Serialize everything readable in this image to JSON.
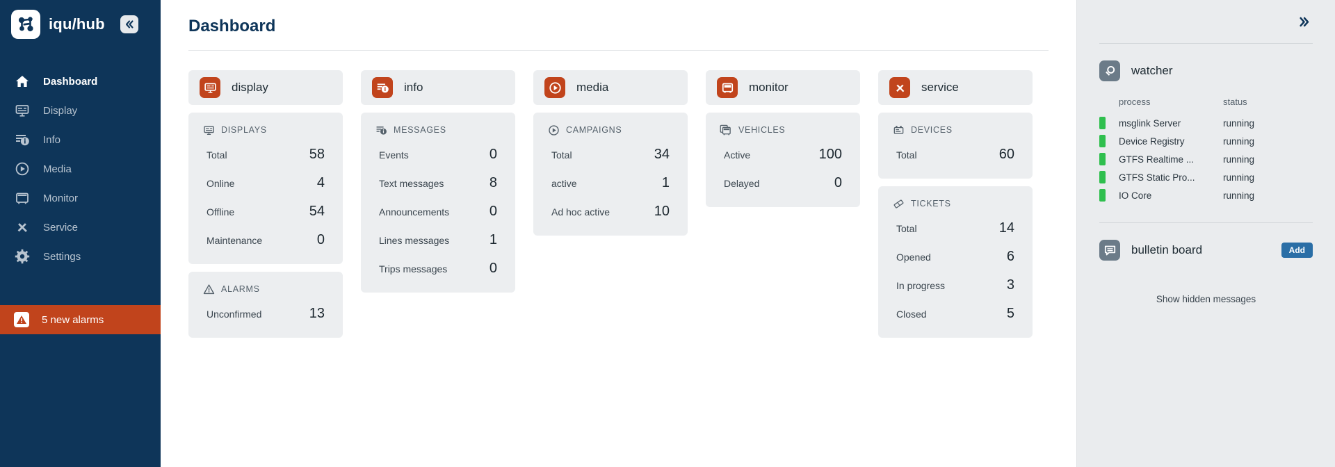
{
  "sidebar": {
    "brand": {
      "name": "iqu/hub",
      "logo_icon": "molecule-logo-icon"
    },
    "collapse_label": "«",
    "items": [
      {
        "label": "Dashboard",
        "icon": "home-icon",
        "active": true
      },
      {
        "label": "Display",
        "icon": "display-board-icon",
        "active": false
      },
      {
        "label": "Info",
        "icon": "info-list-icon",
        "active": false
      },
      {
        "label": "Media",
        "icon": "play-circle-icon",
        "active": false
      },
      {
        "label": "Monitor",
        "icon": "bus-front-icon",
        "active": false
      },
      {
        "label": "Service",
        "icon": "tools-icon",
        "active": false
      },
      {
        "label": "Settings",
        "icon": "gear-icon",
        "active": false
      }
    ],
    "alarm": {
      "label": "5 new alarms",
      "icon": "alarm-warning-icon",
      "color": "#c1441c"
    }
  },
  "header": {
    "title": "Dashboard"
  },
  "colors": {
    "sidebar_bg": "#0e3559",
    "accent_red": "#c1441c",
    "card_bg": "#eceef0",
    "right_panel_bg": "#eaecee",
    "status_green": "#2fbf4e",
    "add_blue": "#2a6ea6"
  },
  "columns": [
    {
      "app": {
        "name": "display",
        "icon": "display-board-icon"
      },
      "panels": [
        {
          "title": "DISPLAYS",
          "icon": "display-board-icon",
          "rows": [
            {
              "label": "Total",
              "value": "58"
            },
            {
              "label": "Online",
              "value": "4"
            },
            {
              "label": "Offline",
              "value": "54"
            },
            {
              "label": "Maintenance",
              "value": "0"
            }
          ]
        },
        {
          "title": "ALARMS",
          "icon": "warning-triangle-icon",
          "rows": [
            {
              "label": "Unconfirmed",
              "value": "13"
            }
          ]
        }
      ]
    },
    {
      "app": {
        "name": "info",
        "icon": "info-list-icon"
      },
      "panels": [
        {
          "title": "MESSAGES",
          "icon": "info-list-icon",
          "rows": [
            {
              "label": "Events",
              "value": "0"
            },
            {
              "label": "Text messages",
              "value": "8"
            },
            {
              "label": "Announcements",
              "value": "0"
            },
            {
              "label": "Lines messages",
              "value": "1"
            },
            {
              "label": "Trips messages",
              "value": "0"
            }
          ]
        }
      ]
    },
    {
      "app": {
        "name": "media",
        "icon": "play-circle-icon"
      },
      "panels": [
        {
          "title": "CAMPAIGNS",
          "icon": "play-circle-icon",
          "rows": [
            {
              "label": "Total",
              "value": "34"
            },
            {
              "label": "active",
              "value": "1"
            },
            {
              "label": "Ad hoc active",
              "value": "10"
            }
          ]
        }
      ]
    },
    {
      "app": {
        "name": "monitor",
        "icon": "bus-front-icon"
      },
      "panels": [
        {
          "title": "VEHICLES",
          "icon": "vehicles-icon",
          "rows": [
            {
              "label": "Active",
              "value": "100"
            },
            {
              "label": "Delayed",
              "value": "0"
            }
          ]
        }
      ]
    },
    {
      "app": {
        "name": "service",
        "icon": "tools-icon"
      },
      "panels": [
        {
          "title": "DEVICES",
          "icon": "device-icon",
          "rows": [
            {
              "label": "Total",
              "value": "60"
            }
          ]
        },
        {
          "title": "TICKETS",
          "icon": "ticket-icon",
          "rows": [
            {
              "label": "Total",
              "value": "14"
            },
            {
              "label": "Opened",
              "value": "6"
            },
            {
              "label": "In progress",
              "value": "3"
            },
            {
              "label": "Closed",
              "value": "5"
            }
          ]
        }
      ]
    }
  ],
  "right_panel": {
    "expand_label": "»",
    "watcher": {
      "title": "watcher",
      "icon": "magnifier-icon",
      "columns": {
        "process": "process",
        "status": "status"
      },
      "rows": [
        {
          "name": "msglink Server",
          "status": "running",
          "state": "ok"
        },
        {
          "name": "Device Registry",
          "status": "running",
          "state": "ok"
        },
        {
          "name": "GTFS Realtime ...",
          "status": "running",
          "state": "ok"
        },
        {
          "name": "GTFS Static Pro...",
          "status": "running",
          "state": "ok"
        },
        {
          "name": "IO Core",
          "status": "running",
          "state": "ok"
        }
      ]
    },
    "bulletin": {
      "title": "bulletin board",
      "icon": "chat-bubble-icon",
      "add_label": "Add",
      "show_hidden_label": "Show hidden messages"
    }
  }
}
